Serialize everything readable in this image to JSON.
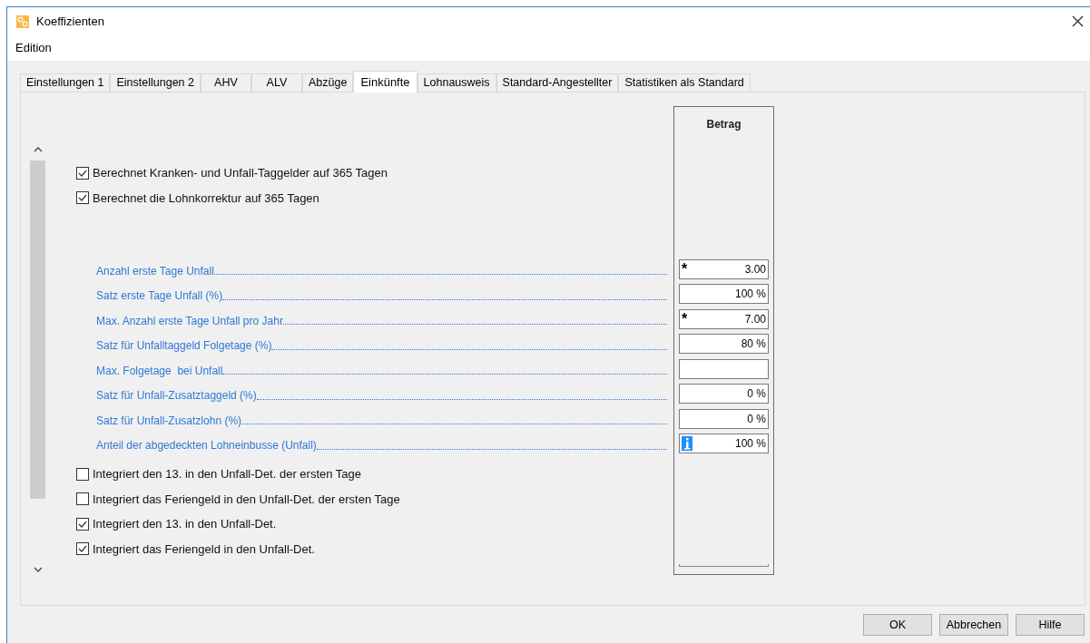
{
  "window": {
    "title": "Koeffizienten"
  },
  "menu": [
    "Edition"
  ],
  "tabs": [
    {
      "label": "Einstellungen 1",
      "selected": false
    },
    {
      "label": "Einstellungen 2",
      "selected": false
    },
    {
      "label": "AHV",
      "selected": false
    },
    {
      "label": "ALV",
      "selected": false
    },
    {
      "label": "Abzüge",
      "selected": false
    },
    {
      "label": "Einkünfte",
      "selected": true
    },
    {
      "label": "Lohnausweis",
      "selected": false
    },
    {
      "label": "Standard-Angestellter",
      "selected": false
    },
    {
      "label": "Statistiken als Standard",
      "selected": false
    }
  ],
  "column_header": "Betrag",
  "top_options": [
    {
      "label": "Berechnet Kranken- und Unfall-Taggelder auf 365 Tagen",
      "checked": true
    },
    {
      "label": "Berechnet die Lohnkorrektur auf 365 Tagen",
      "checked": true
    }
  ],
  "fields": [
    {
      "label": "Anzahl erste Tage Unfall",
      "value": "3.00",
      "marker": "*"
    },
    {
      "label": "Satz erste Tage Unfall (%)",
      "value": "100 %"
    },
    {
      "label": "Max. Anzahl erste Tage Unfall pro Jahr",
      "value": "7.00",
      "marker": "*"
    },
    {
      "label": "Satz für Unfalltaggeld Folgetage (%)",
      "value": "80 %"
    },
    {
      "label": "Max. Folgetage  bei Unfall"
    },
    {
      "label": "Satz für Unfall-Zusatztaggeld (%)",
      "value": "0 %"
    },
    {
      "label": "Satz für Unfall-Zusatzlohn (%)",
      "value": "0 %"
    },
    {
      "label": "Anteil der abgedeckten Lohneinbusse (Unfall)",
      "value": "100 %",
      "info": true
    }
  ],
  "bottom_options": [
    {
      "label": "Integriert den 13. in den Unfall-Det. der ersten Tage",
      "checked": false
    },
    {
      "label": "Integriert das Feriengeld in den Unfall-Det. der ersten Tage",
      "checked": false
    },
    {
      "label": "Integriert den 13. in den Unfall-Det.",
      "checked": true
    },
    {
      "label": "Integriert das Feriengeld in den Unfall-Det.",
      "checked": true
    }
  ],
  "buttons": [
    "OK",
    "Abbrechen",
    "Hilfe"
  ]
}
